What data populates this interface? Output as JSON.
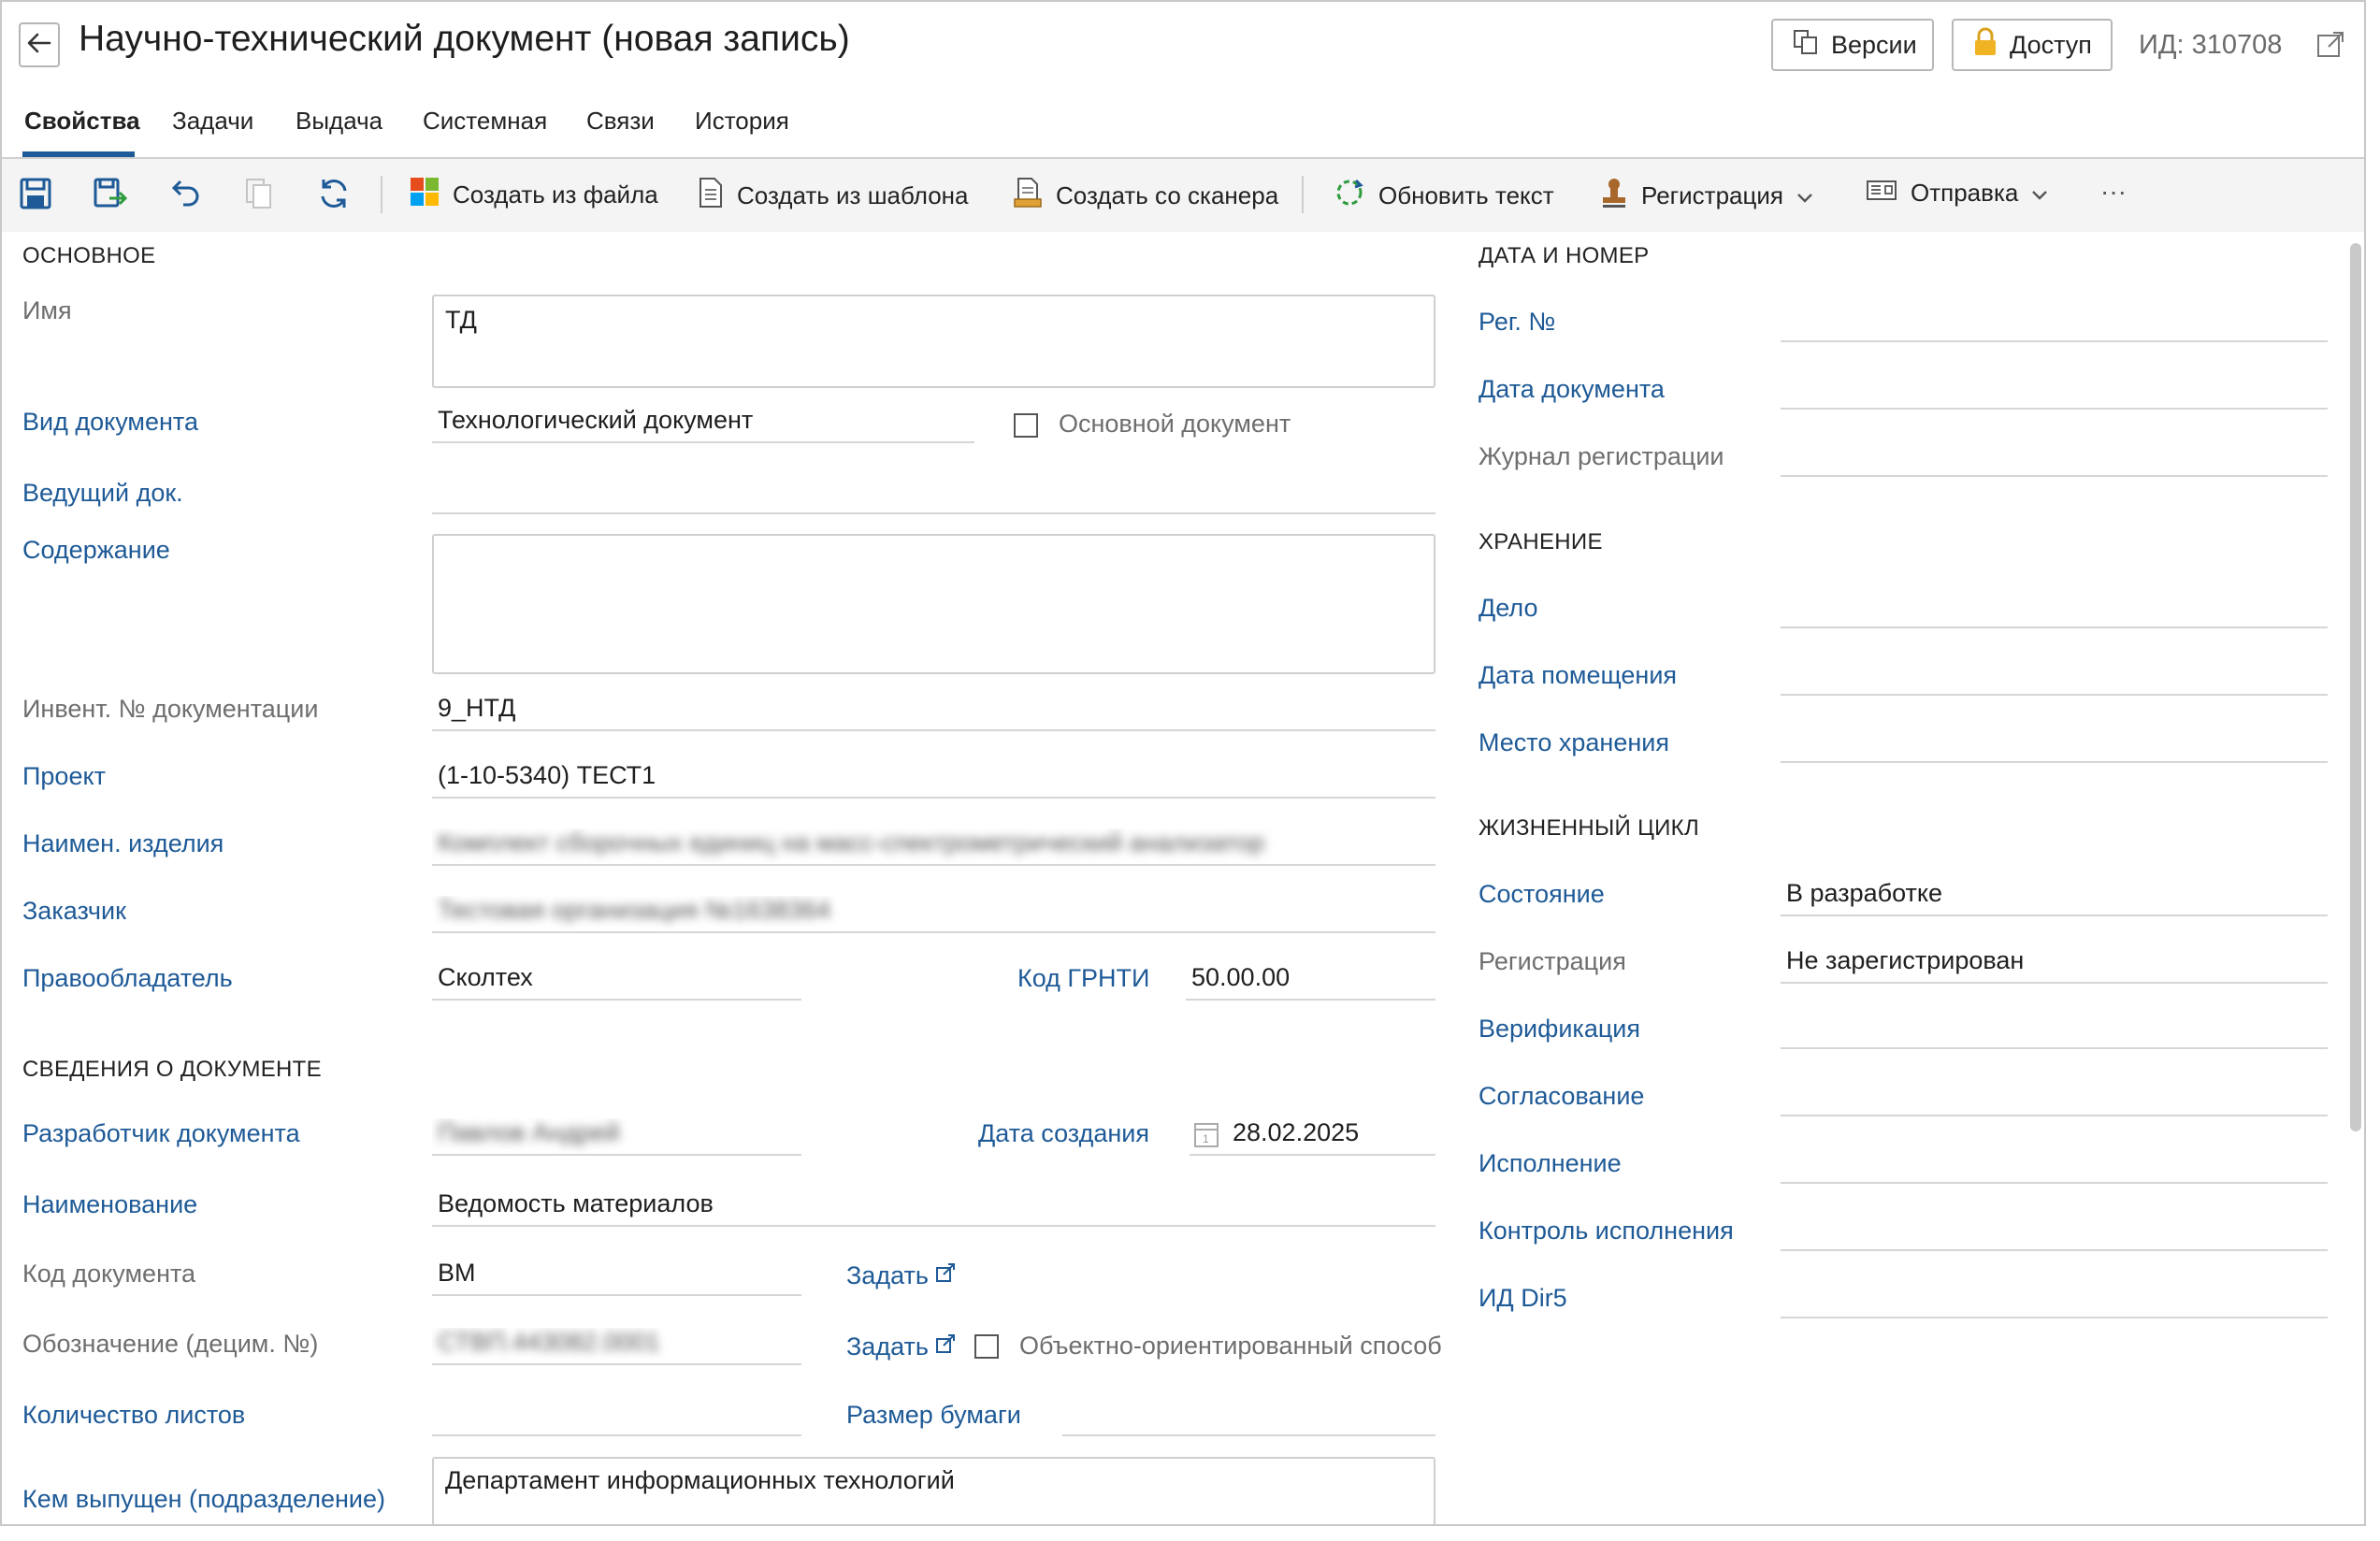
{
  "header": {
    "title": "Научно-технический документ (новая запись)",
    "versions_label": "Версии",
    "access_label": "Доступ",
    "id_text": "ИД: 310708"
  },
  "tabs": [
    {
      "label": "Свойства",
      "active": true
    },
    {
      "label": "Задачи"
    },
    {
      "label": "Выдача"
    },
    {
      "label": "Системная"
    },
    {
      "label": "Связи"
    },
    {
      "label": "История"
    }
  ],
  "toolbar": {
    "create_from_file": "Создать из файла",
    "create_from_template": "Создать из шаблона",
    "create_from_scanner": "Создать со сканера",
    "update_text": "Обновить текст",
    "registration": "Регистрация",
    "sending": "Отправка",
    "more": "···"
  },
  "main": {
    "section_main": "ОСНОВНОЕ",
    "name_label": "Имя",
    "name_value": "ТД",
    "doc_type_label": "Вид документа",
    "doc_type_value": "Технологический документ",
    "main_doc_label": "Основной документ",
    "lead_doc_label": "Ведущий док.",
    "lead_doc_value": "",
    "content_label": "Содержание",
    "content_value": "",
    "inv_label": "Инвент. № документации",
    "inv_value": "9_НТД",
    "project_label": "Проект",
    "project_value": "(1-10-5340) ТЕСТ1",
    "product_label": "Наимен. изделия",
    "product_value": "Комплект сборочных единиц на масс-спектрометрический анализатор",
    "customer_label": "Заказчик",
    "customer_value": "Тестовая организация №1638364",
    "owner_label": "Правообладатель",
    "owner_value": "Сколтех",
    "grnti_label": "Код ГРНТИ",
    "grnti_value": "50.00.00",
    "section_doc": "СВЕДЕНИЯ О ДОКУМЕНТЕ",
    "developer_label": "Разработчик документа",
    "developer_value": "Павлов Андрей",
    "created_label": "Дата создания",
    "created_value": "28.02.2025",
    "title_label": "Наименование",
    "title_value": "Ведомость материалов",
    "code_label": "Код документа",
    "code_value": "ВМ",
    "set_label": "Задать",
    "designation_label": "Обозначение (децим. №)",
    "designation_value": "СТВП.443082.0001",
    "oo_label": "Объектно-ориентированный способ",
    "sheets_label": "Количество листов",
    "sheets_value": "",
    "paper_label": "Размер бумаги",
    "paper_value": "",
    "issued_label": "Кем выпущен (подразделение)",
    "issued_value": "Департамент информационных технологий"
  },
  "right": {
    "section_date": "ДАТА И НОМЕР",
    "reg_no_label": "Рег. №",
    "doc_date_label": "Дата документа",
    "journal_label": "Журнал регистрации",
    "section_storage": "ХРАНЕНИЕ",
    "case_label": "Дело",
    "placed_label": "Дата помещения",
    "place_label": "Место хранения",
    "section_lifecycle": "ЖИЗНЕННЫЙ ЦИКЛ",
    "state_label": "Состояние",
    "state_value": "В разработке",
    "registration_label": "Регистрация",
    "registration_value": "Не зарегистрирован",
    "verification_label": "Верификация",
    "approval_label": "Согласование",
    "execution_label": "Исполнение",
    "control_label": "Контроль исполнения",
    "dir5_label": "ИД Dir5"
  }
}
